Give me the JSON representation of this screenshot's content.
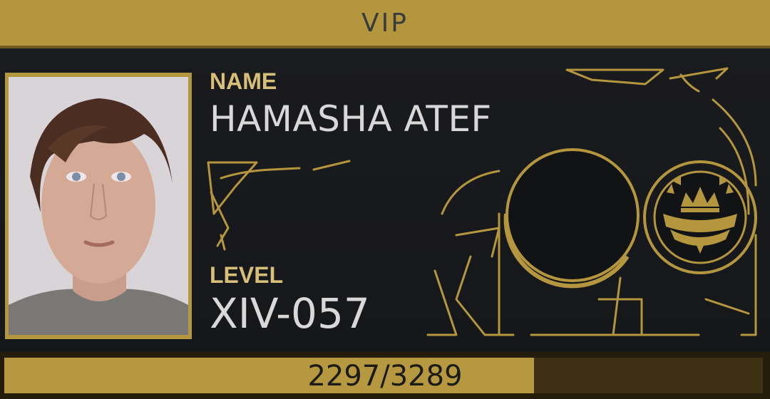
{
  "card": {
    "title": "VIP",
    "name_label": "NAME",
    "name_value": "HAMASHA ATEF",
    "level_label": "LEVEL",
    "level_value": "XIV-057",
    "progress_text": "2297/3289",
    "progress_fraction": 0.698,
    "emblem_icon": "crown-laurel-emblem-icon",
    "portrait_icon": "player-portrait"
  },
  "colors": {
    "gold": "#b4963e",
    "label_gold": "#d7be79",
    "dark": "#17181b",
    "text": "#d8d8d8"
  }
}
